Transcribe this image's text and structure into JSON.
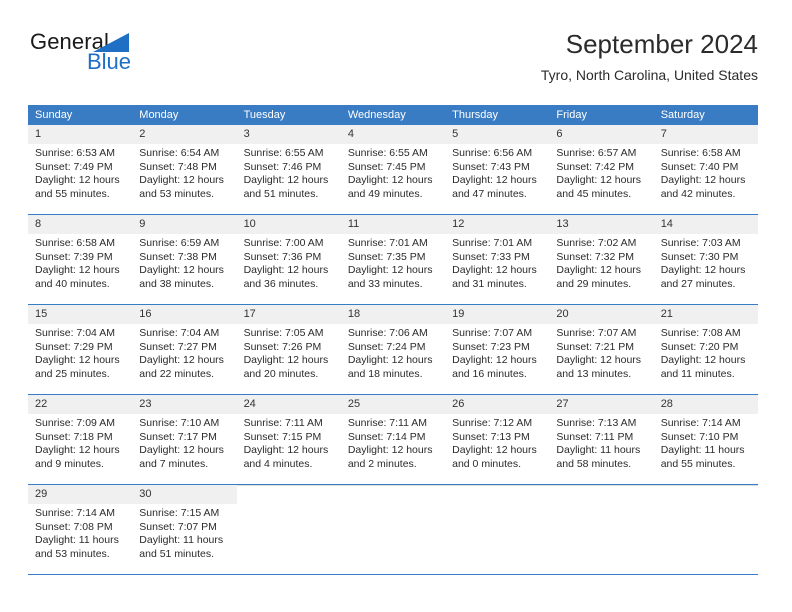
{
  "brand": {
    "word_one": "General",
    "word_two": "Blue",
    "flag_icon": "triangle-flag-icon",
    "accent_color": "#1f6fc4"
  },
  "header": {
    "title": "September 2024",
    "location": "Tyro, North Carolina, United States"
  },
  "calendar": {
    "header_background": "#3a7cc4",
    "day_cell_background": "#f0f0f0",
    "weekday_headers": [
      "Sunday",
      "Monday",
      "Tuesday",
      "Wednesday",
      "Thursday",
      "Friday",
      "Saturday"
    ],
    "weeks": [
      [
        {
          "day": "1",
          "sunrise": "Sunrise: 6:53 AM",
          "sunset": "Sunset: 7:49 PM",
          "daylight_line1": "Daylight: 12 hours",
          "daylight_line2": "and 55 minutes."
        },
        {
          "day": "2",
          "sunrise": "Sunrise: 6:54 AM",
          "sunset": "Sunset: 7:48 PM",
          "daylight_line1": "Daylight: 12 hours",
          "daylight_line2": "and 53 minutes."
        },
        {
          "day": "3",
          "sunrise": "Sunrise: 6:55 AM",
          "sunset": "Sunset: 7:46 PM",
          "daylight_line1": "Daylight: 12 hours",
          "daylight_line2": "and 51 minutes."
        },
        {
          "day": "4",
          "sunrise": "Sunrise: 6:55 AM",
          "sunset": "Sunset: 7:45 PM",
          "daylight_line1": "Daylight: 12 hours",
          "daylight_line2": "and 49 minutes."
        },
        {
          "day": "5",
          "sunrise": "Sunrise: 6:56 AM",
          "sunset": "Sunset: 7:43 PM",
          "daylight_line1": "Daylight: 12 hours",
          "daylight_line2": "and 47 minutes."
        },
        {
          "day": "6",
          "sunrise": "Sunrise: 6:57 AM",
          "sunset": "Sunset: 7:42 PM",
          "daylight_line1": "Daylight: 12 hours",
          "daylight_line2": "and 45 minutes."
        },
        {
          "day": "7",
          "sunrise": "Sunrise: 6:58 AM",
          "sunset": "Sunset: 7:40 PM",
          "daylight_line1": "Daylight: 12 hours",
          "daylight_line2": "and 42 minutes."
        }
      ],
      [
        {
          "day": "8",
          "sunrise": "Sunrise: 6:58 AM",
          "sunset": "Sunset: 7:39 PM",
          "daylight_line1": "Daylight: 12 hours",
          "daylight_line2": "and 40 minutes."
        },
        {
          "day": "9",
          "sunrise": "Sunrise: 6:59 AM",
          "sunset": "Sunset: 7:38 PM",
          "daylight_line1": "Daylight: 12 hours",
          "daylight_line2": "and 38 minutes."
        },
        {
          "day": "10",
          "sunrise": "Sunrise: 7:00 AM",
          "sunset": "Sunset: 7:36 PM",
          "daylight_line1": "Daylight: 12 hours",
          "daylight_line2": "and 36 minutes."
        },
        {
          "day": "11",
          "sunrise": "Sunrise: 7:01 AM",
          "sunset": "Sunset: 7:35 PM",
          "daylight_line1": "Daylight: 12 hours",
          "daylight_line2": "and 33 minutes."
        },
        {
          "day": "12",
          "sunrise": "Sunrise: 7:01 AM",
          "sunset": "Sunset: 7:33 PM",
          "daylight_line1": "Daylight: 12 hours",
          "daylight_line2": "and 31 minutes."
        },
        {
          "day": "13",
          "sunrise": "Sunrise: 7:02 AM",
          "sunset": "Sunset: 7:32 PM",
          "daylight_line1": "Daylight: 12 hours",
          "daylight_line2": "and 29 minutes."
        },
        {
          "day": "14",
          "sunrise": "Sunrise: 7:03 AM",
          "sunset": "Sunset: 7:30 PM",
          "daylight_line1": "Daylight: 12 hours",
          "daylight_line2": "and 27 minutes."
        }
      ],
      [
        {
          "day": "15",
          "sunrise": "Sunrise: 7:04 AM",
          "sunset": "Sunset: 7:29 PM",
          "daylight_line1": "Daylight: 12 hours",
          "daylight_line2": "and 25 minutes."
        },
        {
          "day": "16",
          "sunrise": "Sunrise: 7:04 AM",
          "sunset": "Sunset: 7:27 PM",
          "daylight_line1": "Daylight: 12 hours",
          "daylight_line2": "and 22 minutes."
        },
        {
          "day": "17",
          "sunrise": "Sunrise: 7:05 AM",
          "sunset": "Sunset: 7:26 PM",
          "daylight_line1": "Daylight: 12 hours",
          "daylight_line2": "and 20 minutes."
        },
        {
          "day": "18",
          "sunrise": "Sunrise: 7:06 AM",
          "sunset": "Sunset: 7:24 PM",
          "daylight_line1": "Daylight: 12 hours",
          "daylight_line2": "and 18 minutes."
        },
        {
          "day": "19",
          "sunrise": "Sunrise: 7:07 AM",
          "sunset": "Sunset: 7:23 PM",
          "daylight_line1": "Daylight: 12 hours",
          "daylight_line2": "and 16 minutes."
        },
        {
          "day": "20",
          "sunrise": "Sunrise: 7:07 AM",
          "sunset": "Sunset: 7:21 PM",
          "daylight_line1": "Daylight: 12 hours",
          "daylight_line2": "and 13 minutes."
        },
        {
          "day": "21",
          "sunrise": "Sunrise: 7:08 AM",
          "sunset": "Sunset: 7:20 PM",
          "daylight_line1": "Daylight: 12 hours",
          "daylight_line2": "and 11 minutes."
        }
      ],
      [
        {
          "day": "22",
          "sunrise": "Sunrise: 7:09 AM",
          "sunset": "Sunset: 7:18 PM",
          "daylight_line1": "Daylight: 12 hours",
          "daylight_line2": "and 9 minutes."
        },
        {
          "day": "23",
          "sunrise": "Sunrise: 7:10 AM",
          "sunset": "Sunset: 7:17 PM",
          "daylight_line1": "Daylight: 12 hours",
          "daylight_line2": "and 7 minutes."
        },
        {
          "day": "24",
          "sunrise": "Sunrise: 7:11 AM",
          "sunset": "Sunset: 7:15 PM",
          "daylight_line1": "Daylight: 12 hours",
          "daylight_line2": "and 4 minutes."
        },
        {
          "day": "25",
          "sunrise": "Sunrise: 7:11 AM",
          "sunset": "Sunset: 7:14 PM",
          "daylight_line1": "Daylight: 12 hours",
          "daylight_line2": "and 2 minutes."
        },
        {
          "day": "26",
          "sunrise": "Sunrise: 7:12 AM",
          "sunset": "Sunset: 7:13 PM",
          "daylight_line1": "Daylight: 12 hours",
          "daylight_line2": "and 0 minutes."
        },
        {
          "day": "27",
          "sunrise": "Sunrise: 7:13 AM",
          "sunset": "Sunset: 7:11 PM",
          "daylight_line1": "Daylight: 11 hours",
          "daylight_line2": "and 58 minutes."
        },
        {
          "day": "28",
          "sunrise": "Sunrise: 7:14 AM",
          "sunset": "Sunset: 7:10 PM",
          "daylight_line1": "Daylight: 11 hours",
          "daylight_line2": "and 55 minutes."
        }
      ],
      [
        {
          "day": "29",
          "sunrise": "Sunrise: 7:14 AM",
          "sunset": "Sunset: 7:08 PM",
          "daylight_line1": "Daylight: 11 hours",
          "daylight_line2": "and 53 minutes."
        },
        {
          "day": "30",
          "sunrise": "Sunrise: 7:15 AM",
          "sunset": "Sunset: 7:07 PM",
          "daylight_line1": "Daylight: 11 hours",
          "daylight_line2": "and 51 minutes."
        },
        {
          "day": "",
          "sunrise": "",
          "sunset": "",
          "daylight_line1": "",
          "daylight_line2": ""
        },
        {
          "day": "",
          "sunrise": "",
          "sunset": "",
          "daylight_line1": "",
          "daylight_line2": ""
        },
        {
          "day": "",
          "sunrise": "",
          "sunset": "",
          "daylight_line1": "",
          "daylight_line2": ""
        },
        {
          "day": "",
          "sunrise": "",
          "sunset": "",
          "daylight_line1": "",
          "daylight_line2": ""
        },
        {
          "day": "",
          "sunrise": "",
          "sunset": "",
          "daylight_line1": "",
          "daylight_line2": ""
        }
      ]
    ]
  }
}
